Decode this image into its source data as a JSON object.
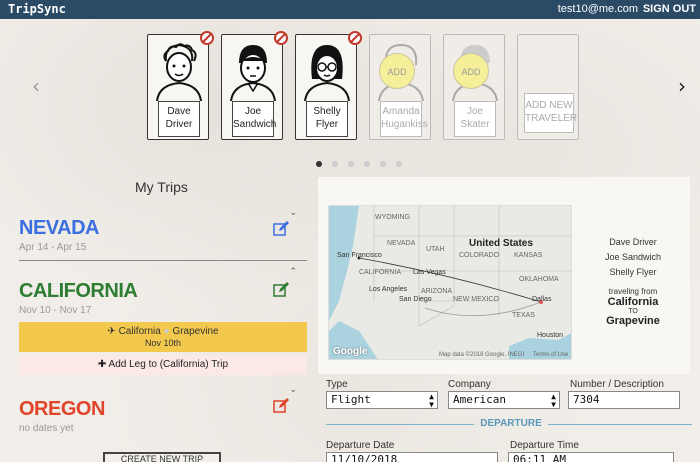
{
  "topbar": {
    "brand": "TripSync",
    "account": "test10@me.com",
    "sign_out": "SIGN OUT"
  },
  "carousel": {
    "prev_arrow": "‹",
    "next_arrow": "›",
    "travelers": [
      {
        "line1": "Dave",
        "line2": "Driver",
        "type": "person"
      },
      {
        "line1": "Joe",
        "line2": "Sandwich",
        "type": "person"
      },
      {
        "line1": "Shelly",
        "line2": "Flyer",
        "type": "person"
      },
      {
        "line1": "Amanda",
        "line2": "Hugankiss",
        "add_label": "ADD",
        "type": "add"
      },
      {
        "line1": "Joe",
        "line2": "Skater",
        "add_label": "ADD",
        "type": "add"
      },
      {
        "line1": "ADD NEW",
        "line2": "TRAVELER",
        "type": "new"
      }
    ],
    "page_count": 6,
    "active_page": 1
  },
  "my_trips": {
    "heading": "My Trips",
    "trips": [
      {
        "name": "NEVADA",
        "dates": "Apr 14 - Apr 15",
        "color": "#3b6fe0"
      },
      {
        "name": "CALIFORNIA",
        "dates": "Nov 10 - Nov 17",
        "color": "#2e7d32"
      },
      {
        "name": "OREGON",
        "dates": "no dates yet",
        "color": "#e0442b"
      }
    ],
    "leg": {
      "from": "California",
      "to": "Grapevine",
      "date": "Nov 10th"
    },
    "add_leg": "Add Leg to (California) Trip",
    "create_button": "CREATE NEW TRIP"
  },
  "map": {
    "labels": {
      "wyoming": "WYOMING",
      "nevada": "NEVADA",
      "utah": "UTAH",
      "united_states": "United States",
      "colorado": "COLORADO",
      "kansas": "KANSAS",
      "san_francisco": "San Francisco",
      "california": "CALIFORNIA",
      "las_vegas": "Las Vegas",
      "oklahoma": "OKLAHOMA",
      "los_angeles": "Los Angeles",
      "arizona": "ARIZONA",
      "san_diego": "San Diego",
      "new_mexico": "NEW MEXICO",
      "dallas": "Dallas",
      "texas": "TEXAS",
      "houston": "Houston",
      "google": "Google",
      "map_data": "Map data ©2018 Google, INEGI",
      "terms": "Terms of Use"
    },
    "travelers_list": [
      "Dave Driver",
      "Joe Sandwich",
      "Shelly Flyer"
    ],
    "traveling_from_label": "traveling from",
    "from": "California",
    "to_label": "TO",
    "to": "Grapevine"
  },
  "form": {
    "type_label": "Type",
    "type_value": "Flight",
    "company_label": "Company",
    "company_value": "American",
    "number_label": "Number / Description",
    "number_value": "7304",
    "section": "DEPARTURE",
    "dep_date_label": "Departure Date",
    "dep_date_value": "11/10/2018",
    "dep_time_label": "Departure Time",
    "dep_time_value": "06:11 AM"
  },
  "colors": {
    "topbar": "#2b4a66",
    "leg_bar": "#f2c94c",
    "add_leg_bg": "#fbe9e6",
    "edit_icon": "#d9534f"
  }
}
